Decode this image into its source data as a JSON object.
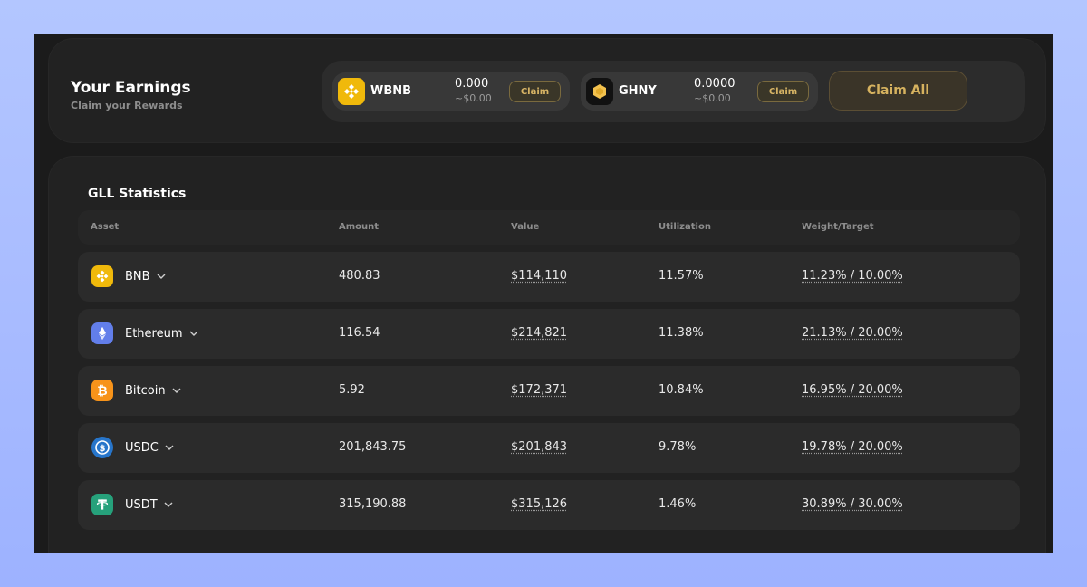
{
  "earnings": {
    "title": "Your Earnings",
    "subtitle": "Claim your Rewards",
    "tokens": [
      {
        "symbol": "WBNB",
        "amount": "0.000",
        "usd": "~$0.00",
        "claim_label": "Claim",
        "icon": "wbnb-icon",
        "color": "#f0b90b"
      },
      {
        "symbol": "GHNY",
        "amount": "0.0000",
        "usd": "~$0.00",
        "claim_label": "Claim",
        "icon": "ghny-icon",
        "color": "#f2c14e"
      }
    ],
    "claim_all_label": "Claim All"
  },
  "stats": {
    "title": "GLL Statistics",
    "columns": [
      "Asset",
      "Amount",
      "Value",
      "Utilization",
      "Weight/Target"
    ],
    "rows": [
      {
        "asset": "BNB",
        "icon": "bnb-icon",
        "color": "#f0b90b",
        "amount": "480.83",
        "value": "$114,110",
        "utilization": "11.57%",
        "weight_target": "11.23% / 10.00%"
      },
      {
        "asset": "Ethereum",
        "icon": "ethereum-icon",
        "color": "#627eea",
        "amount": "116.54",
        "value": "$214,821",
        "utilization": "11.38%",
        "weight_target": "21.13% / 20.00%"
      },
      {
        "asset": "Bitcoin",
        "icon": "bitcoin-icon",
        "color": "#f7931a",
        "amount": "5.92",
        "value": "$172,371",
        "utilization": "10.84%",
        "weight_target": "16.95% / 20.00%"
      },
      {
        "asset": "USDC",
        "icon": "usdc-icon",
        "color": "#2775ca",
        "amount": "201,843.75",
        "value": "$201,843",
        "utilization": "9.78%",
        "weight_target": "19.78% / 20.00%"
      },
      {
        "asset": "USDT",
        "icon": "usdt-icon",
        "color": "#26a17b",
        "amount": "315,190.88",
        "value": "$315,126",
        "utilization": "1.46%",
        "weight_target": "30.89% / 30.00%"
      }
    ]
  },
  "colors": {
    "accent_gold": "#d6b25f",
    "background": "#1b1b1b",
    "page_gradient": "#a9bcff"
  }
}
